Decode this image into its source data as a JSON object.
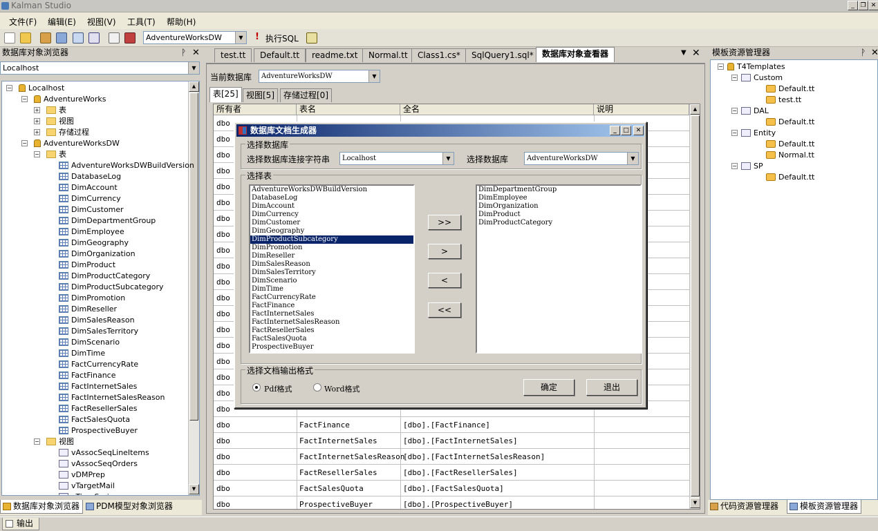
{
  "app": {
    "title": "Kalman Studio"
  },
  "menu": [
    "文件(F)",
    "编辑(E)",
    "视图(V)",
    "工具(T)",
    "帮助(H)"
  ],
  "toolbar": {
    "db_combo": "AdventureWorksDW",
    "execute_label": "执行SQL"
  },
  "left_panel": {
    "title": "数据库对象浏览器",
    "server_combo": "Localhost",
    "tree": {
      "root": "Localhost",
      "db1": "AdventureWorks",
      "db1_children": [
        "表",
        "视图",
        "存储过程"
      ],
      "db2": "AdventureWorksDW",
      "tables_label": "表",
      "tables": [
        "AdventureWorksDWBuildVersion",
        "DatabaseLog",
        "DimAccount",
        "DimCurrency",
        "DimCustomer",
        "DimDepartmentGroup",
        "DimEmployee",
        "DimGeography",
        "DimOrganization",
        "DimProduct",
        "DimProductCategory",
        "DimProductSubcategory",
        "DimPromotion",
        "DimReseller",
        "DimSalesReason",
        "DimSalesTerritory",
        "DimScenario",
        "DimTime",
        "FactCurrencyRate",
        "FactFinance",
        "FactInternetSales",
        "FactInternetSalesReason",
        "FactResellerSales",
        "FactSalesQuota",
        "ProspectiveBuyer"
      ],
      "views_label": "视图",
      "views": [
        "vAssocSeqLineItems",
        "vAssocSeqOrders",
        "vDMPrep",
        "vTargetMail",
        "vTimeSeries"
      ]
    },
    "bottom_tabs": [
      "数据库对象浏览器",
      "PDM模型对象浏览器"
    ]
  },
  "doc_tabs": [
    "test.tt",
    "Default.tt",
    "readme.txt",
    "Normal.tt",
    "Class1.cs*",
    "SqlQuery1.sql*",
    "数据库对象查看器"
  ],
  "viewer": {
    "db_label": "当前数据库",
    "db_value": "AdventureWorksDW",
    "subtabs": [
      "表[25]",
      "视图[5]",
      "存储过程[0]"
    ],
    "columns": [
      "所有者",
      "表名",
      "全名",
      "说明"
    ],
    "rows": [
      {
        "owner": "dbo",
        "name": "",
        "full": ""
      },
      {
        "owner": "dbo",
        "name": "",
        "full": ""
      },
      {
        "owner": "dbo",
        "name": "",
        "full": ""
      },
      {
        "owner": "dbo",
        "name": "",
        "full": ""
      },
      {
        "owner": "dbo",
        "name": "",
        "full": ""
      },
      {
        "owner": "dbo",
        "name": "",
        "full": ""
      },
      {
        "owner": "dbo",
        "name": "",
        "full": ""
      },
      {
        "owner": "dbo",
        "name": "",
        "full": ""
      },
      {
        "owner": "dbo",
        "name": "",
        "full": ""
      },
      {
        "owner": "dbo",
        "name": "",
        "full": ""
      },
      {
        "owner": "dbo",
        "name": "",
        "full": ""
      },
      {
        "owner": "dbo",
        "name": "",
        "full": ""
      },
      {
        "owner": "dbo",
        "name": "",
        "full": ""
      },
      {
        "owner": "dbo",
        "name": "",
        "full": ""
      },
      {
        "owner": "dbo",
        "name": "",
        "full": ""
      },
      {
        "owner": "dbo",
        "name": "",
        "full": ""
      },
      {
        "owner": "dbo",
        "name": "",
        "full": ""
      },
      {
        "owner": "dbo",
        "name": "",
        "full": ""
      },
      {
        "owner": "dbo",
        "name": "",
        "full": ""
      },
      {
        "owner": "dbo",
        "name": "FactFinance",
        "full": "[dbo].[FactFinance]"
      },
      {
        "owner": "dbo",
        "name": "FactInternetSales",
        "full": "[dbo].[FactInternetSales]"
      },
      {
        "owner": "dbo",
        "name": "FactInternetSalesReason",
        "full": "[dbo].[FactInternetSalesReason]"
      },
      {
        "owner": "dbo",
        "name": "FactResellerSales",
        "full": "[dbo].[FactResellerSales]"
      },
      {
        "owner": "dbo",
        "name": "FactSalesQuota",
        "full": "[dbo].[FactSalesQuota]"
      },
      {
        "owner": "dbo",
        "name": "ProspectiveBuyer",
        "full": "[dbo].[ProspectiveBuyer]"
      }
    ]
  },
  "dialog": {
    "title": "数据库文档生成器",
    "select_db_group": "选择数据库",
    "conn_label": "选择数据库连接字符串",
    "conn_value": "Localhost",
    "db_label": "选择数据库",
    "db_value": "AdventureWorksDW",
    "select_table_group": "选择表",
    "available": [
      "AdventureWorksDWBuildVersion",
      "DatabaseLog",
      "DimAccount",
      "DimCurrency",
      "DimCustomer",
      "DimGeography",
      "DimProductSubcategory",
      "DimPromotion",
      "DimReseller",
      "DimSalesReason",
      "DimSalesTerritory",
      "DimScenario",
      "DimTime",
      "FactCurrencyRate",
      "FactFinance",
      "FactInternetSales",
      "FactInternetSalesReason",
      "FactResellerSales",
      "FactSalesQuota",
      "ProspectiveBuyer"
    ],
    "selected_index": 6,
    "chosen": [
      "DimDepartmentGroup",
      "DimEmployee",
      "DimOrganization",
      "DimProduct",
      "DimProductCategory"
    ],
    "btn_add_all": ">>",
    "btn_add": ">",
    "btn_remove": "<",
    "btn_remove_all": "<<",
    "format_group": "选择文档输出格式",
    "pdf_label": "Pdf格式",
    "word_label": "Word格式",
    "ok": "确定",
    "exit": "退出"
  },
  "right_panel": {
    "title": "模板资源管理器",
    "tree": [
      {
        "label": "T4Templates",
        "level": 0,
        "kind": "root"
      },
      {
        "label": "Custom",
        "level": 1,
        "kind": "folder"
      },
      {
        "label": "Default.tt",
        "level": 2,
        "kind": "file"
      },
      {
        "label": "test.tt",
        "level": 2,
        "kind": "file"
      },
      {
        "label": "DAL",
        "level": 1,
        "kind": "folder"
      },
      {
        "label": "Default.tt",
        "level": 2,
        "kind": "file"
      },
      {
        "label": "Entity",
        "level": 1,
        "kind": "folder"
      },
      {
        "label": "Default.tt",
        "level": 2,
        "kind": "file"
      },
      {
        "label": "Normal.tt",
        "level": 2,
        "kind": "file"
      },
      {
        "label": "SP",
        "level": 1,
        "kind": "folder"
      },
      {
        "label": "Default.tt",
        "level": 2,
        "kind": "file"
      }
    ],
    "bottom_tabs": [
      "代码资源管理器",
      "模板资源管理器"
    ]
  },
  "status": {
    "output_tab": "输出"
  }
}
